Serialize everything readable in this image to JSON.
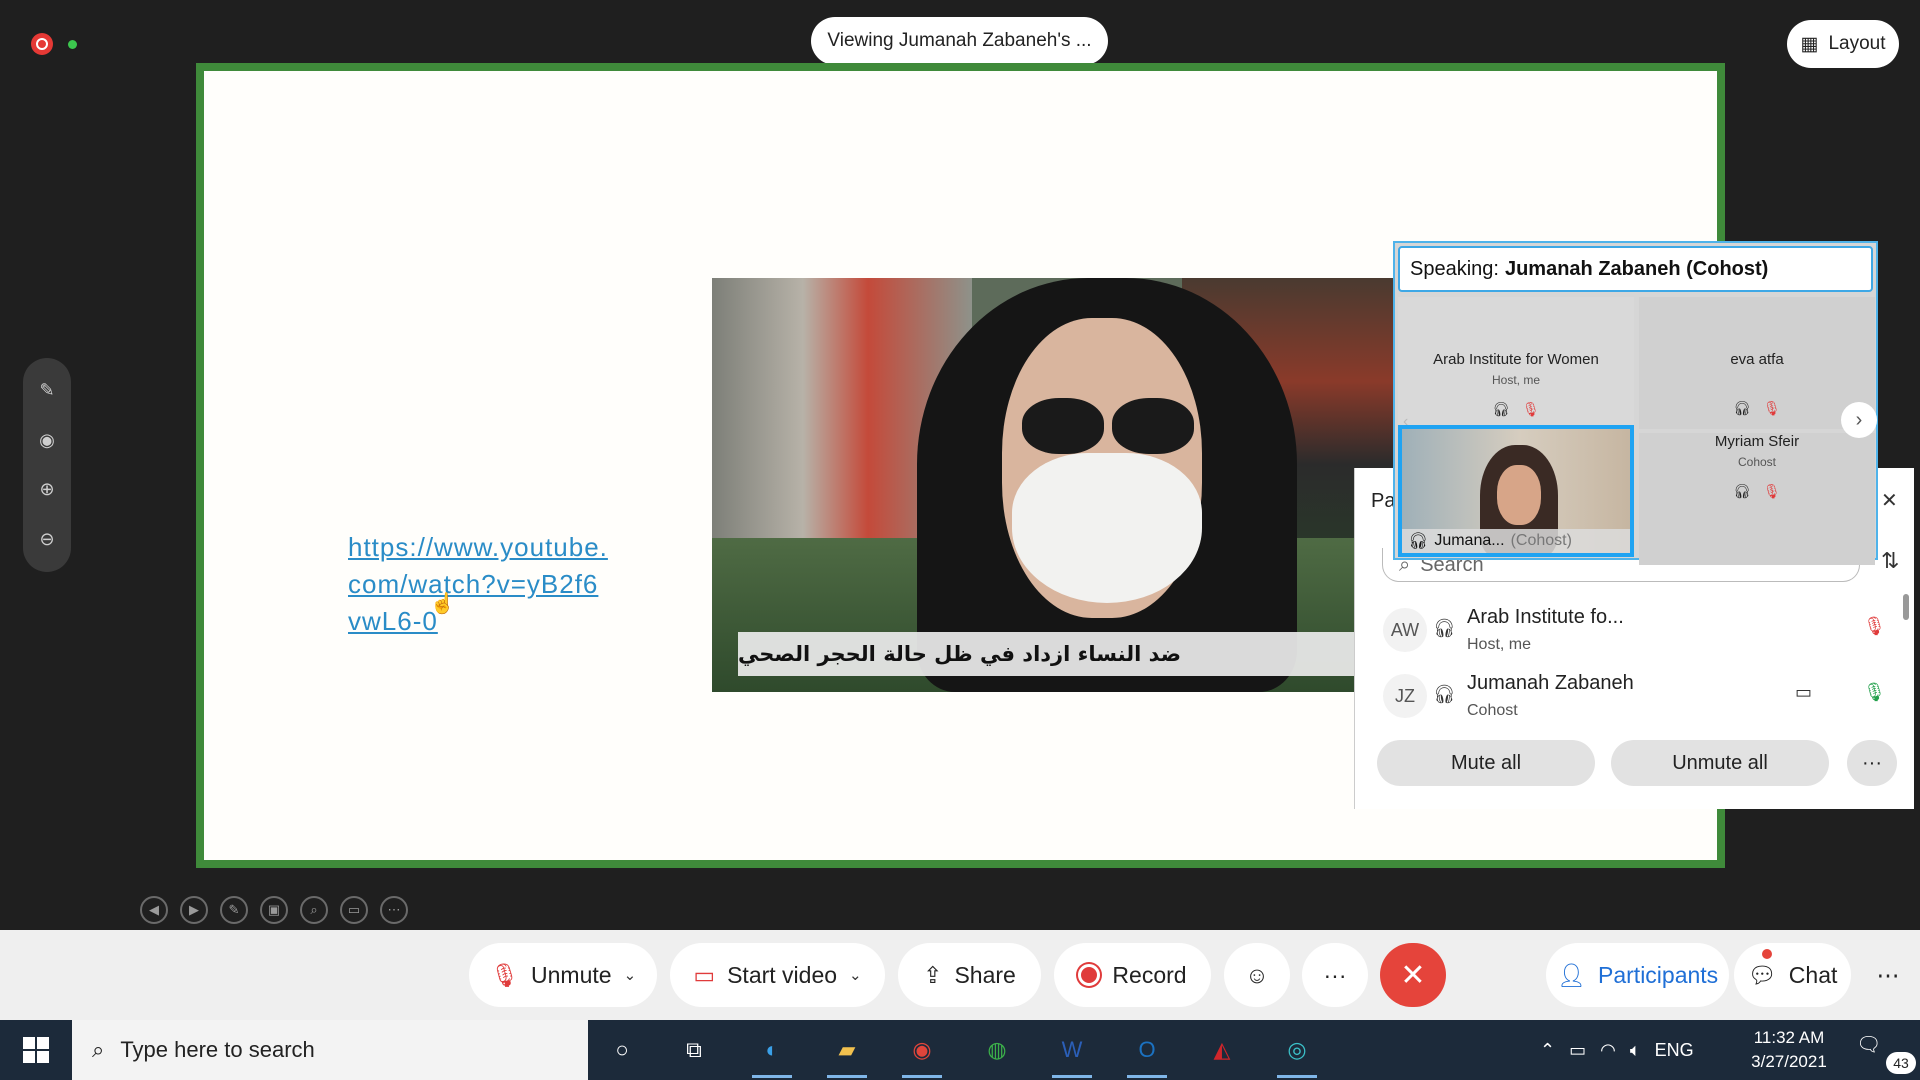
{
  "top": {
    "viewing_label": "Viewing Jumanah Zabaneh's ...",
    "layout_label": "Layout"
  },
  "slide": {
    "link_text": "https://www.youtube.com/watch?v=yB2f6vwL6-0",
    "video_caption": "ضد النساء ازداد في ظل حالة الحجر الصحي"
  },
  "speaking_panel": {
    "prefix": "Speaking:",
    "speaker": "Jumanah Zabaneh (Cohost)",
    "tiles": [
      {
        "name": "Arab Institute for Women",
        "role": "Host, me"
      },
      {
        "name": "eva atfa",
        "role": ""
      },
      {
        "name": "Jumana...",
        "role": "(Cohost)"
      },
      {
        "name": "Myriam Sfeir",
        "role": "Cohost"
      }
    ]
  },
  "participants_panel": {
    "title": "Pa",
    "search_placeholder": "Search",
    "rows": [
      {
        "initials": "AW",
        "name": "Arab Institute fo...",
        "role": "Host, me"
      },
      {
        "initials": "JZ",
        "name": "Jumanah Zabaneh",
        "role": "Cohost"
      }
    ],
    "mute_all": "Mute all",
    "unmute_all": "Unmute all",
    "more": "···"
  },
  "control_bar": {
    "unmute": "Unmute",
    "start_video": "Start video",
    "share": "Share",
    "record": "Record",
    "more": "···",
    "participants": "Participants",
    "chat": "Chat"
  },
  "taskbar": {
    "search_placeholder": "Type here to search",
    "language": "ENG",
    "time": "11:32 AM",
    "date": "3/27/2021",
    "notification_count": "43"
  },
  "colors": {
    "share_border": "#3f8a3a",
    "active_speaker_border": "#1fa3f2",
    "end_button": "#e5443b",
    "mic_off": "#e03b3b",
    "mic_on": "#22a04b",
    "participants_accent": "#1f6fd6"
  }
}
